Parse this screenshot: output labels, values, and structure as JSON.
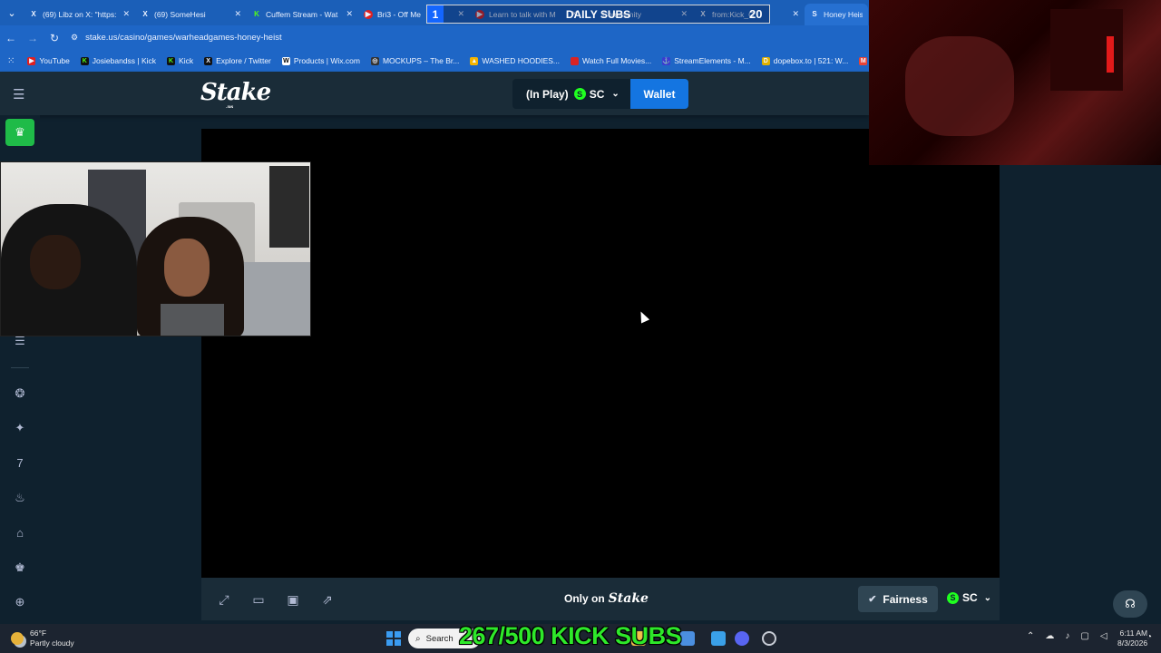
{
  "browser": {
    "tabs": [
      {
        "icon": "x-icon",
        "favicon_text": "X",
        "title": "(69) Libz on X: \"https:",
        "active": false
      },
      {
        "icon": "x-icon",
        "favicon_text": "X",
        "title": "(69) SomeHesi",
        "active": false
      },
      {
        "icon": "kick-icon",
        "favicon_text": "K",
        "title": "Cuffem Stream - Wat",
        "active": false
      },
      {
        "icon": "youtube-icon",
        "favicon_text": "▶",
        "title": "Bri3 - Off Me",
        "active": false
      },
      {
        "icon": "youtube-icon",
        "favicon_text": "▶",
        "title": "Learn to talk with M",
        "active": false
      },
      {
        "icon": "community-icon",
        "favicon_text": "",
        "title": "Community",
        "active": false
      },
      {
        "icon": "x-icon",
        "favicon_text": "X",
        "title": "from:Kick_C",
        "active": false
      },
      {
        "icon": "stake-icon",
        "favicon_text": "S",
        "title": "Honey Heist F",
        "active": true
      }
    ],
    "url": "stake.us/casino/games/warheadgames-honey-heist",
    "bookmarks": [
      {
        "icon": "youtube-icon",
        "label": "YouTube",
        "color": "#e02020",
        "glyph": "▶"
      },
      {
        "icon": "kick-icon",
        "label": "Josiebandss | Kick",
        "color": "#111111",
        "glyph": "K"
      },
      {
        "icon": "kick-icon",
        "label": "Kick",
        "color": "#111111",
        "glyph": "K"
      },
      {
        "icon": "x-icon",
        "label": "Explore / Twitter",
        "color": "#111111",
        "glyph": "X"
      },
      {
        "icon": "wix-icon",
        "label": "Products | Wix.com",
        "color": "#ffffff",
        "glyph": "W"
      },
      {
        "icon": "mockups-icon",
        "label": "MOCKUPS – The Br...",
        "color": "#333333",
        "glyph": "◎"
      },
      {
        "icon": "drive-icon",
        "label": "WASHED HOODIES...",
        "color": "#f4b400",
        "glyph": "▲"
      },
      {
        "icon": "movies-icon",
        "label": "Watch Full Movies...",
        "color": "#d92323",
        "glyph": ""
      },
      {
        "icon": "streamelements-icon",
        "label": "StreamElements - M...",
        "color": "#3b3bd0",
        "glyph": "⚓"
      },
      {
        "icon": "dopebox-icon",
        "label": "dopebox.to | 521: W...",
        "color": "#e0b000",
        "glyph": "D"
      },
      {
        "icon": "gmail-icon",
        "label": "Gmail",
        "color": "#ea4335",
        "glyph": "M"
      }
    ]
  },
  "stake": {
    "logo": "Stake",
    "logo_sub": ".us",
    "balance_label": "(In Play)",
    "currency": "SC",
    "wallet_label": "Wallet",
    "only_on_label": "Only on",
    "only_on_brand": "Stake",
    "fairness_label": "Fairness",
    "footer_currency": "SC"
  },
  "overlay": {
    "daily_subs_label": "DAILY SUBS",
    "daily_subs_left": "1",
    "daily_subs_right": "20",
    "kick_subs": "267/500 KICK SUBS"
  },
  "taskbar": {
    "temperature": "66°F",
    "condition": "Partly cloudy",
    "search_label": "Search",
    "time": "6:11 AM",
    "date": "8/3/2026"
  },
  "colors": {
    "accent_blue": "#1475e1",
    "stake_green": "#1fff20",
    "bg": "#0f212e",
    "panel": "#1a2c38"
  }
}
